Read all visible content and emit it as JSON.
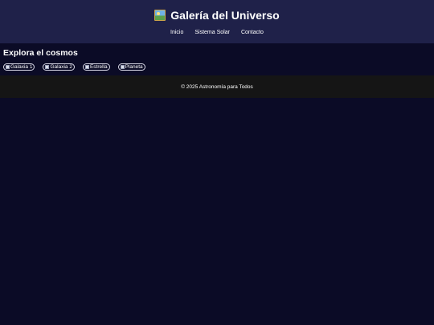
{
  "header": {
    "logo_icon": "framed-picture-icon",
    "title": "Galería del Universo",
    "nav": [
      {
        "label": "Inicio"
      },
      {
        "label": "Sistema Solar"
      },
      {
        "label": "Contacto"
      }
    ]
  },
  "main": {
    "heading": "Explora el cosmos",
    "gallery": [
      {
        "alt": "Galaxia 1",
        "icon": "broken-image-icon"
      },
      {
        "alt": "Galaxia 2",
        "icon": "broken-image-icon"
      },
      {
        "alt": "Estrella",
        "icon": "broken-image-icon"
      },
      {
        "alt": "Planeta",
        "icon": "broken-image-icon"
      }
    ]
  },
  "footer": {
    "text": "© 2025 Astronomía para Todos"
  },
  "colors": {
    "header_bg": "#1f2149",
    "page_bg": "#0b0b26",
    "footer_bg": "#151515",
    "text": "#ffffff"
  }
}
